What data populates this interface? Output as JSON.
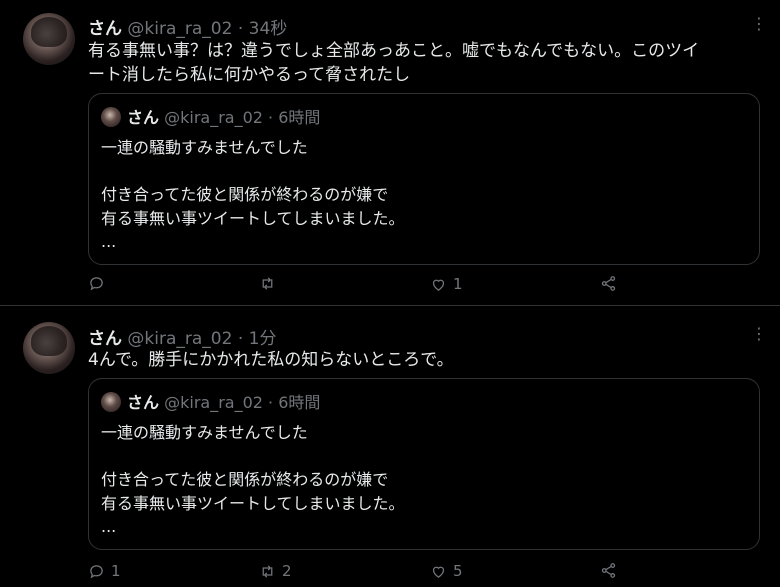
{
  "tweets": [
    {
      "name": "さん",
      "handle": "@kira_ra_02",
      "sep": " · ",
      "time": "34秒",
      "more": "⋮",
      "text_lines": [
        "有る事無い事？は？違うでしょ全部あっあこと。嘘でもなんでもない。このツイ",
        "ート消したら私に何かやるって脅されたし"
      ],
      "quote": {
        "name": "さん",
        "handle": "@kira_ra_02",
        "sep": " · ",
        "time": "6時間",
        "lines": [
          "一連の騒動すみませんでした",
          "付き合ってた彼と関係が終わるのが嫌で",
          "有る事無い事ツイートしてしまいました。",
          "..."
        ]
      },
      "actions": {
        "reply": "",
        "retweet": "",
        "like": "1"
      }
    },
    {
      "name": "さん",
      "handle": "@kira_ra_02",
      "sep": " · ",
      "time": "1分",
      "more": "⋮",
      "text_lines": [
        "4んで。勝手にかかれた私の知らないところで。"
      ],
      "quote": {
        "name": "さん",
        "handle": "@kira_ra_02",
        "sep": " · ",
        "time": "6時間",
        "lines": [
          "一連の騒動すみませんでした",
          "付き合ってた彼と関係が終わるのが嫌で",
          "有る事無い事ツイートしてしまいました。",
          "..."
        ]
      },
      "actions": {
        "reply": "1",
        "retweet": "2",
        "like": "5"
      }
    }
  ],
  "icons": {
    "reply": "reply-icon",
    "retweet": "retweet-icon",
    "like": "heart-icon",
    "share": "share-icon"
  },
  "colors": {
    "background": "#000000",
    "text": "#e7e9ea",
    "muted": "#71767b",
    "border": "#2f3336"
  }
}
